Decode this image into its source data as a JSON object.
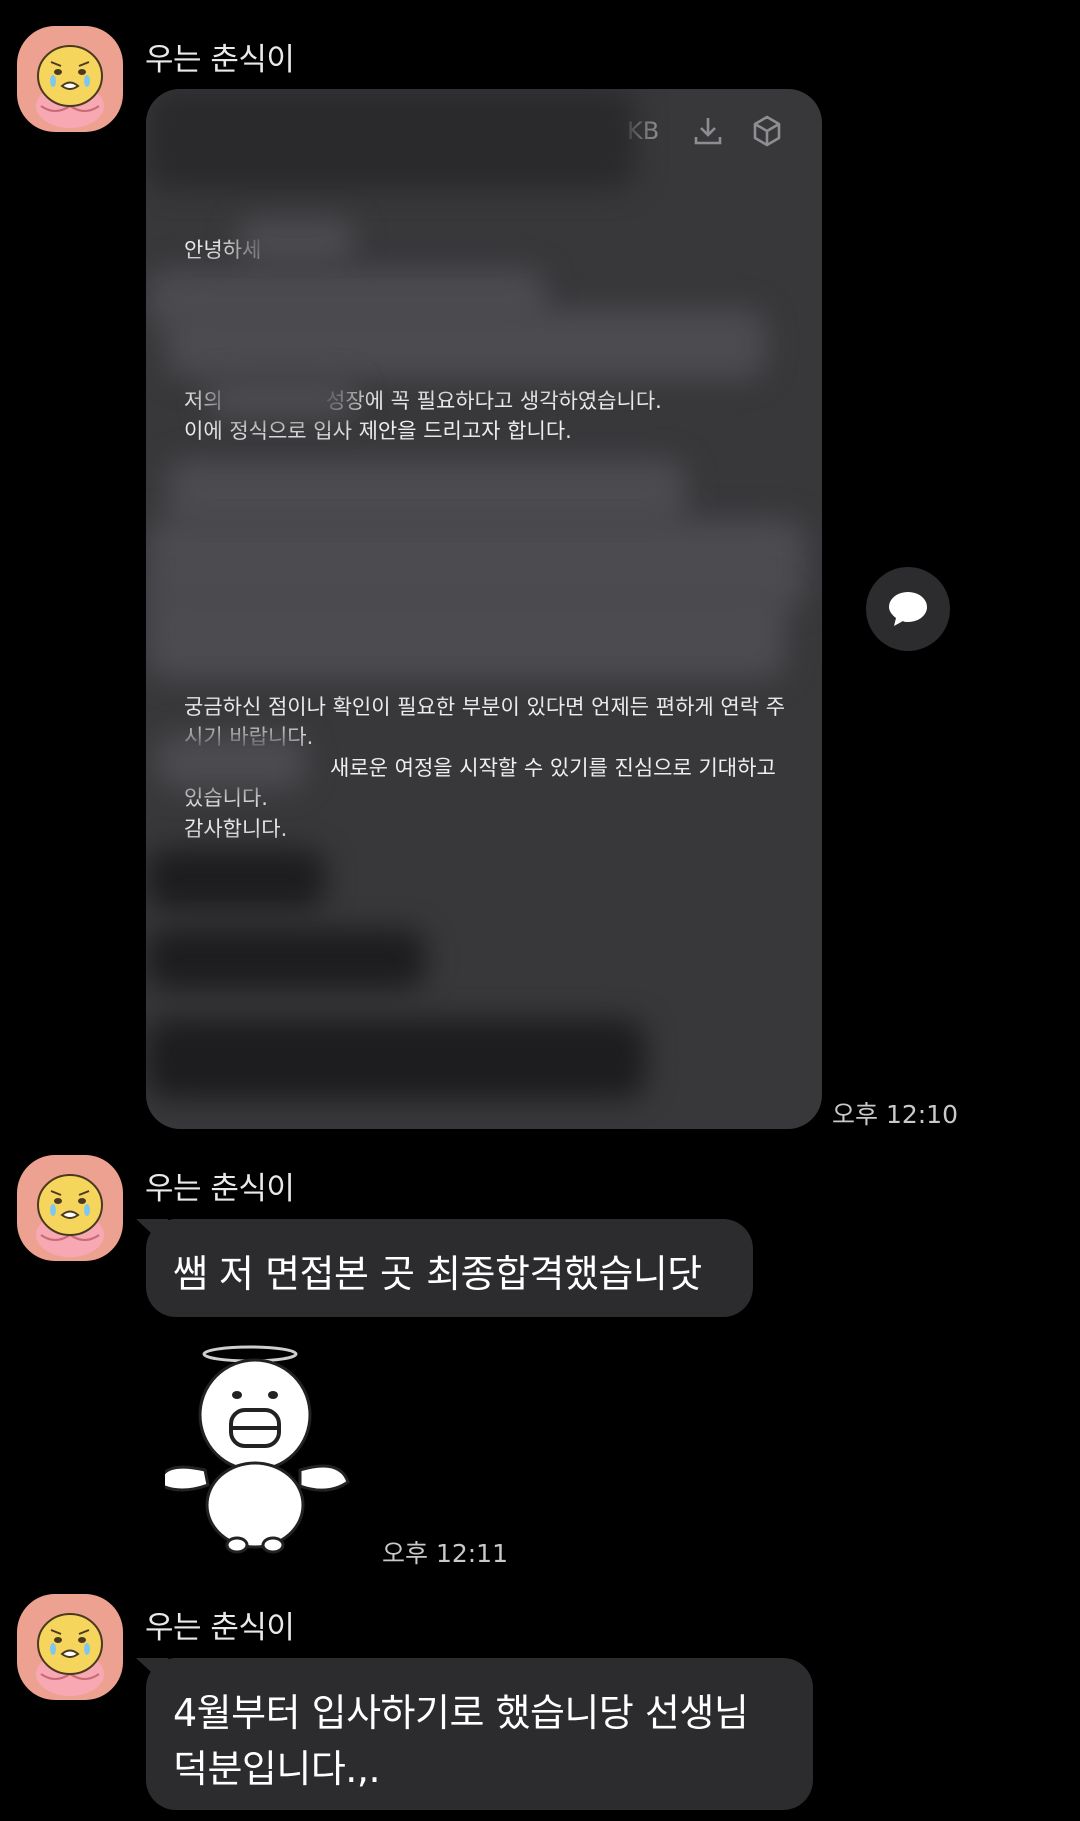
{
  "messages": [
    {
      "sender": "우는 춘식이",
      "time": "오후 12:10",
      "type": "document",
      "document": {
        "size_label": "KB",
        "lines": {
          "l1": "안녕하세",
          "l2": "저의",
          "l2b": "성장에 꼭 필요하다고 생각하였습니다.",
          "l3": "이에 정식으로 입사 제안을 드리고자 합니다.",
          "l4": "궁금하신 점이나 확인이 필요한 부분이 있다면 언제든 편하게 연락 주",
          "l5": "시기 바랍니다.",
          "l6": "새로운 여정을 시작할 수 있기를 진심으로 기대하고",
          "l7": "있습니다.",
          "l8": "감사합니다."
        }
      }
    },
    {
      "sender": "우는 춘식이",
      "text": "쌤 저 면접본 곳 최종합격했습니닷"
    },
    {
      "type": "sticker",
      "sticker": "angel-character-sticker",
      "time": "오후 12:11"
    },
    {
      "sender": "우는 춘식이",
      "lines": [
        "4월부터 입사하기로 했습니당 선생님",
        "덕분입니다.,."
      ]
    }
  ],
  "icons": {
    "download": "download-icon",
    "cube": "cube-icon",
    "reply": "speech-bubble-icon",
    "avatar": "chunsik-avatar"
  },
  "colors": {
    "background": "#000000",
    "bubble": "#2c2c2f",
    "document": "#38383b",
    "avatar_bg": "#eda191"
  }
}
